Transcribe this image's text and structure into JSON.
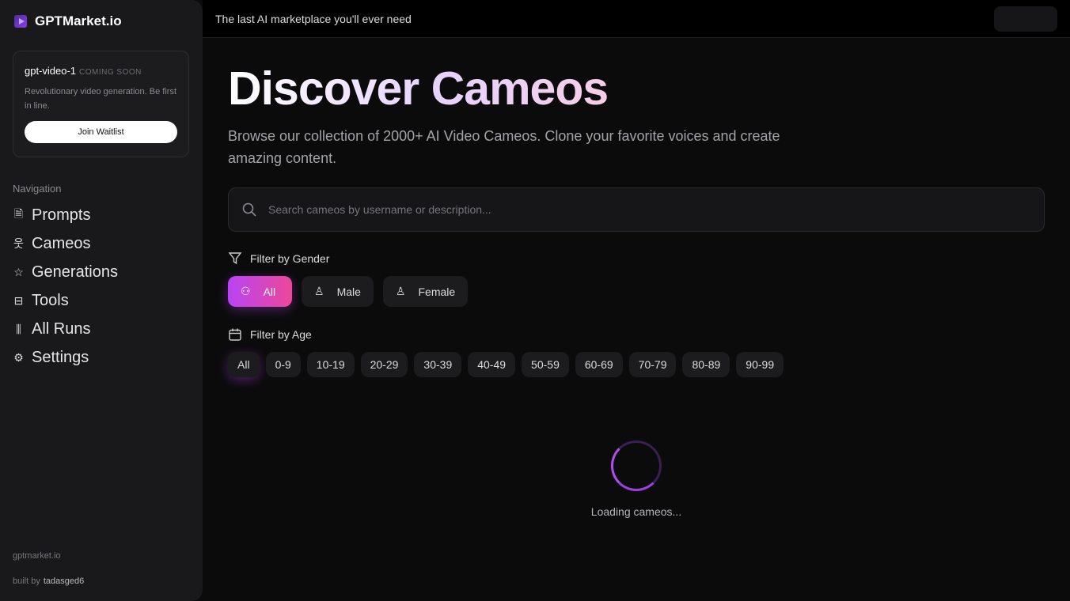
{
  "brand": "GPTMarket.io",
  "promo": {
    "title": "gpt-video-1",
    "badge": "COMING SOON",
    "desc": "Revolutionary video generation. Be first in line.",
    "button": "Join Waitlist"
  },
  "nav": {
    "label": "Navigation",
    "items": [
      {
        "label": "Prompts",
        "icon": "document-icon"
      },
      {
        "label": "Cameos",
        "icon": "person-icon"
      },
      {
        "label": "Generations",
        "icon": "star-icon"
      },
      {
        "label": "Tools",
        "icon": "toolbox-icon"
      },
      {
        "label": "All Runs",
        "icon": "library-icon"
      },
      {
        "label": "Settings",
        "icon": "gear-icon"
      }
    ]
  },
  "footer": {
    "site": "gptmarket.io",
    "built_by": "built by",
    "author": "tadasged6"
  },
  "topbar": {
    "tagline": "The last AI marketplace you'll ever need"
  },
  "main": {
    "title": "Discover Cameos",
    "subtitle": "Browse our collection of 2000+ AI Video Cameos. Clone your favorite voices and create amazing content.",
    "search_placeholder": "Search cameos by username or description...",
    "gender_label": "Filter by Gender",
    "genders": [
      "All",
      "Male",
      "Female"
    ],
    "age_label": "Filter by Age",
    "ages": [
      "All",
      "0-9",
      "10-19",
      "20-29",
      "30-39",
      "40-49",
      "50-59",
      "60-69",
      "70-79",
      "80-89",
      "90-99"
    ],
    "loading": "Loading cameos..."
  },
  "colors": {
    "accent_start": "#b944f5",
    "accent_end": "#ec4899"
  }
}
